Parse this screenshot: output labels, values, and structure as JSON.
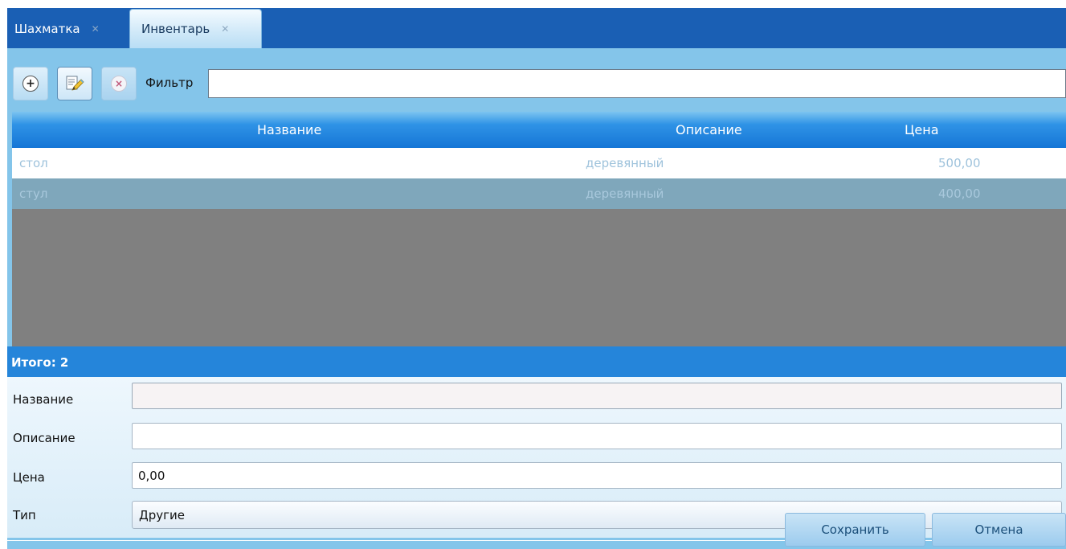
{
  "tabs": [
    {
      "label": "Шахматка",
      "close": "✕"
    },
    {
      "label": "Инвентарь",
      "close": "✕"
    }
  ],
  "toolbar": {
    "add_icon": "plus-circle-icon",
    "edit_icon": "edit-pencil-icon",
    "delete_icon": "delete-circle-icon",
    "add_glyph": "+",
    "delete_glyph": "×",
    "filter_label": "Фильтр",
    "filter_value": ""
  },
  "grid": {
    "columns": [
      "Название",
      "Описание",
      "Цена"
    ],
    "rows": [
      {
        "name": "стол",
        "description": "деревянный",
        "price": "500,00"
      },
      {
        "name": "стул",
        "description": "деревянный",
        "price": "400,00"
      }
    ]
  },
  "total": {
    "label": "Итого: 2"
  },
  "form": {
    "name_label": "Название",
    "name_value": "",
    "description_label": "Описание",
    "description_value": "",
    "price_label": "Цена",
    "price_value": "0,00",
    "type_label": "Тип",
    "type_value": "Другие"
  },
  "actions": {
    "save": "Сохранить",
    "cancel": "Отмена"
  },
  "colors": {
    "tab_strip": "#1a5fb4",
    "panel": "#84c5ea",
    "header": "#1576d6",
    "total_bar": "#2585da",
    "empty_grid": "#808080"
  }
}
